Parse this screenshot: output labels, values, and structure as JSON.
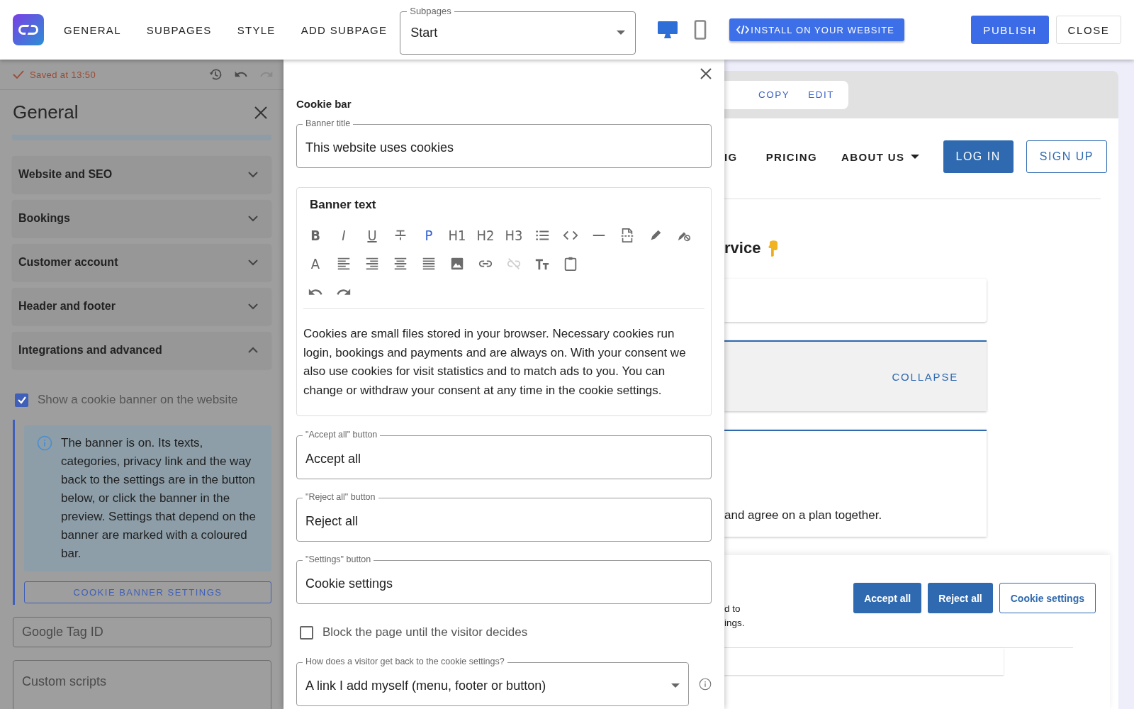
{
  "topbar": {
    "nav": [
      {
        "label": "GENERAL"
      },
      {
        "label": "SUBPAGES"
      },
      {
        "label": "STYLE"
      },
      {
        "label": "ADD SUBPAGE"
      }
    ],
    "subpage_select": {
      "label": "Subpages",
      "value": "Start"
    },
    "devices": [
      {
        "kind": "desktop",
        "selected": true
      },
      {
        "kind": "phone",
        "selected": false
      }
    ],
    "install_button": "INSTALL ON YOUR WEBSITE",
    "publish_button": "PUBLISH",
    "close_button": "CLOSE"
  },
  "left_panel": {
    "saved": "Saved at 13:50",
    "title": "General",
    "sections": [
      {
        "label": "Website and SEO",
        "expanded": false
      },
      {
        "label": "Bookings",
        "expanded": false
      },
      {
        "label": "Customer account",
        "expanded": false
      },
      {
        "label": "Header and footer",
        "expanded": false
      },
      {
        "label": "Integrations and advanced",
        "expanded": true
      }
    ],
    "cookie_checkbox": {
      "label": "Show a cookie banner on the website",
      "checked": true
    },
    "info": "The banner is on. Its texts, categories, privacy link and the way back to the settings are in the button below, or click the banner in the preview. Settings that depend on the banner are marked with a coloured bar.",
    "settings_button": "COOKIE BANNER SETTINGS",
    "fields": [
      {
        "kind": "line",
        "placeholder": "Google Tag ID"
      },
      {
        "kind": "area",
        "placeholder": "Custom scripts"
      }
    ]
  },
  "dialog": {
    "heading": "Cookie bar",
    "banner_title": {
      "label": "Banner title",
      "value": "This website uses cookies"
    },
    "banner_text": {
      "label": "Banner text",
      "toolbar": [
        [
          {
            "kind": "bold",
            "glyph": "B",
            "active": false,
            "disabled": false
          },
          {
            "kind": "italic",
            "glyph": "I",
            "active": false,
            "disabled": false
          },
          {
            "kind": "underline",
            "glyph": "U",
            "active": false,
            "disabled": false
          },
          {
            "kind": "strike",
            "active": false,
            "disabled": false
          },
          {
            "kind": "heading",
            "glyph": "P",
            "active": true,
            "disabled": false
          },
          {
            "kind": "heading",
            "glyph": "H1",
            "active": false,
            "disabled": false
          },
          {
            "kind": "heading",
            "glyph": "H2",
            "active": false,
            "disabled": false
          },
          {
            "kind": "heading",
            "glyph": "H3",
            "active": false,
            "disabled": false
          },
          {
            "kind": "list",
            "active": false,
            "disabled": false
          },
          {
            "kind": "code",
            "active": false,
            "disabled": false
          },
          {
            "kind": "rule",
            "active": false,
            "disabled": false
          },
          {
            "kind": "pagebreak",
            "active": false,
            "disabled": false
          },
          {
            "kind": "highlight",
            "active": false,
            "disabled": false
          },
          {
            "kind": "clearformat",
            "active": false,
            "disabled": false
          }
        ],
        [
          {
            "kind": "heading",
            "glyph": "A",
            "active": false,
            "disabled": false
          },
          {
            "kind": "alignleft",
            "active": false,
            "disabled": false
          },
          {
            "kind": "alignright",
            "active": false,
            "disabled": false
          },
          {
            "kind": "aligncenter",
            "active": false,
            "disabled": false
          },
          {
            "kind": "justify",
            "active": false,
            "disabled": false
          },
          {
            "kind": "image",
            "active": false,
            "disabled": false
          },
          {
            "kind": "link",
            "active": false,
            "disabled": false
          },
          {
            "kind": "unlink",
            "active": false,
            "disabled": true
          },
          {
            "kind": "textsize",
            "active": false,
            "disabled": false
          },
          {
            "kind": "clipboard",
            "active": false,
            "disabled": false
          }
        ],
        [
          {
            "kind": "undo",
            "active": false,
            "disabled": false
          },
          {
            "kind": "redo",
            "active": false,
            "disabled": false
          }
        ]
      ],
      "body": "Cookies are small files stored in your browser. Necessary cookies run login, bookings and payments and are always on. With your consent we also use cookies for visit statistics and to match ads to you. You can change or withdraw your consent at any time in the cookie settings."
    },
    "button_fields": [
      {
        "label": "\"Accept all\" button",
        "value": "Accept all"
      },
      {
        "label": "\"Reject all\" button",
        "value": "Reject all"
      },
      {
        "label": "\"Settings\" button",
        "value": "Cookie settings"
      }
    ],
    "block_checkbox": {
      "label": "Block the page until the visitor decides",
      "checked": false
    },
    "return_select": {
      "label": "How does a visitor get back to the cookie settings?",
      "value": "A link I add myself (menu, footer or button)"
    }
  },
  "preview": {
    "toolbar": [
      {
        "label": "COPY"
      },
      {
        "label": "EDIT"
      }
    ],
    "nav": [
      {
        "kind": "link",
        "label": "IG"
      },
      {
        "kind": "link",
        "label": "PRICING"
      },
      {
        "kind": "dropdown",
        "label": "ABOUT US"
      }
    ],
    "nav_buttons": [
      {
        "kind": "filled",
        "label": "LOG IN"
      },
      {
        "kind": "outline",
        "label": "SIGN UP"
      }
    ],
    "heading": "rvice",
    "collapse": "COLLAPSE",
    "card_text": "and agree on a plan together.",
    "banner_lines": [
      "d to",
      "ings."
    ],
    "banner_buttons": [
      {
        "kind": "filled",
        "label": "Accept all"
      },
      {
        "kind": "filled",
        "label": "Reject all"
      },
      {
        "kind": "outline",
        "label": "Cookie settings"
      }
    ]
  }
}
